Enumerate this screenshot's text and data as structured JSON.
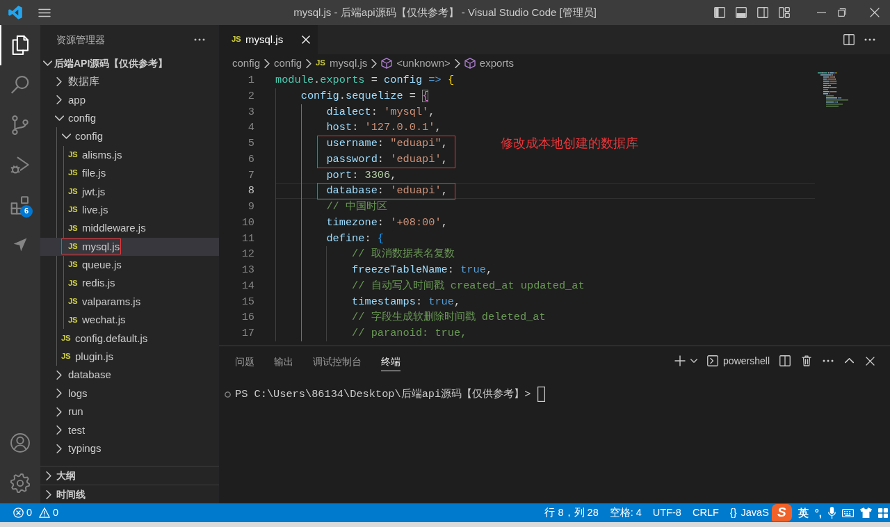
{
  "window": {
    "title": "mysql.js - 后端api源码【仅供参考】 - Visual Studio Code [管理员]"
  },
  "activity_bar": {
    "items": [
      {
        "kind": "explorer",
        "selected": true
      },
      {
        "kind": "search",
        "selected": false
      },
      {
        "kind": "source-control",
        "selected": false
      },
      {
        "kind": "run-debug",
        "selected": false
      },
      {
        "kind": "extensions",
        "selected": false,
        "badge": "6"
      },
      {
        "kind": "send",
        "selected": false
      }
    ],
    "bottom": [
      {
        "kind": "account"
      },
      {
        "kind": "settings"
      }
    ]
  },
  "sidebar": {
    "title": "资源管理器",
    "tree": {
      "label": "后端API源码【仅供参考】",
      "expanded": true,
      "children": [
        {
          "kind": "folder",
          "label": "数据库",
          "expanded": false,
          "selected": false,
          "marked": false
        },
        {
          "kind": "folder",
          "label": "app",
          "expanded": false,
          "selected": false,
          "marked": false
        },
        {
          "kind": "folder",
          "label": "config",
          "expanded": true,
          "selected": false,
          "marked": false,
          "children": [
            {
              "kind": "folder",
              "label": "config",
              "expanded": true,
              "selected": false,
              "marked": false,
              "children": [
                {
                  "kind": "file",
                  "icon_text": "JS",
                  "label": "alisms.js",
                  "selected": false,
                  "marked": false
                },
                {
                  "kind": "file",
                  "icon_text": "JS",
                  "label": "file.js",
                  "selected": false,
                  "marked": false
                },
                {
                  "kind": "file",
                  "icon_text": "JS",
                  "label": "jwt.js",
                  "selected": false,
                  "marked": false
                },
                {
                  "kind": "file",
                  "icon_text": "JS",
                  "label": "live.js",
                  "selected": false,
                  "marked": false
                },
                {
                  "kind": "file",
                  "icon_text": "JS",
                  "label": "middleware.js",
                  "selected": false,
                  "marked": false
                },
                {
                  "kind": "file",
                  "icon_text": "JS",
                  "label": "mysql.js",
                  "selected": true,
                  "marked": true
                },
                {
                  "kind": "file",
                  "icon_text": "JS",
                  "label": "queue.js",
                  "selected": false,
                  "marked": false
                },
                {
                  "kind": "file",
                  "icon_text": "JS",
                  "label": "redis.js",
                  "selected": false,
                  "marked": false
                },
                {
                  "kind": "file",
                  "icon_text": "JS",
                  "label": "valparams.js",
                  "selected": false,
                  "marked": false
                },
                {
                  "kind": "file",
                  "icon_text": "JS",
                  "label": "wechat.js",
                  "selected": false,
                  "marked": false
                }
              ]
            },
            {
              "kind": "file",
              "icon_text": "JS",
              "label": "config.default.js",
              "selected": false,
              "marked": false
            },
            {
              "kind": "file",
              "icon_text": "JS",
              "label": "plugin.js",
              "selected": false,
              "marked": false
            }
          ]
        },
        {
          "kind": "folder",
          "label": "database",
          "expanded": false,
          "selected": false,
          "marked": false
        },
        {
          "kind": "folder",
          "label": "logs",
          "expanded": false,
          "selected": false,
          "marked": false
        },
        {
          "kind": "folder",
          "label": "run",
          "expanded": false,
          "selected": false,
          "marked": false
        },
        {
          "kind": "folder",
          "label": "test",
          "expanded": false,
          "selected": false,
          "marked": false
        },
        {
          "kind": "folder",
          "label": "typings",
          "expanded": false,
          "selected": false,
          "marked": false
        }
      ]
    },
    "sections": [
      {
        "label": "大纲",
        "expanded": false
      },
      {
        "label": "时间线",
        "expanded": false
      }
    ]
  },
  "editor": {
    "tabs": [
      {
        "icon_text": "JS",
        "label": "mysql.js",
        "selected": true
      }
    ],
    "breadcrumbs": [
      {
        "kind": "folder",
        "label": "config"
      },
      {
        "kind": "folder",
        "label": "config"
      },
      {
        "kind": "file",
        "icon_text": "JS",
        "label": "mysql.js"
      },
      {
        "kind": "symbol",
        "label": "<unknown>"
      },
      {
        "kind": "symbol",
        "label": "exports"
      }
    ],
    "code": [
      {
        "number": "1",
        "current": false,
        "marked": false,
        "tokens": [
          {
            "kind": "obj",
            "text": "module"
          },
          {
            "kind": "punct",
            "text": "."
          },
          {
            "kind": "obj",
            "text": "exports"
          },
          {
            "kind": "punct",
            "text": " = "
          },
          {
            "kind": "var",
            "text": "config"
          },
          {
            "kind": "kw",
            "text": " => "
          },
          {
            "kind": "brace1",
            "text": "{"
          }
        ],
        "children": [
          {
            "number": "2",
            "current": false,
            "marked": false,
            "tokens": [
              {
                "kind": "var",
                "text": "config"
              },
              {
                "kind": "punct",
                "text": "."
              },
              {
                "kind": "var",
                "text": "sequelize"
              },
              {
                "kind": "punct",
                "text": " = "
              },
              {
                "kind": "brace-match",
                "text": "{"
              }
            ],
            "children": [
              {
                "number": "3",
                "current": false,
                "marked": false,
                "tokens": [
                  {
                    "kind": "prop",
                    "text": "dialect"
                  },
                  {
                    "kind": "punct",
                    "text": ": "
                  },
                  {
                    "kind": "str",
                    "text": "'mysql'"
                  },
                  {
                    "kind": "punct",
                    "text": ","
                  }
                ]
              },
              {
                "number": "4",
                "current": false,
                "marked": false,
                "tokens": [
                  {
                    "kind": "prop",
                    "text": "host"
                  },
                  {
                    "kind": "punct",
                    "text": ": "
                  },
                  {
                    "kind": "str",
                    "text": "'127.0.0.1'"
                  },
                  {
                    "kind": "punct",
                    "text": ","
                  }
                ]
              },
              {
                "number": "5",
                "current": false,
                "marked": true,
                "tokens": [
                  {
                    "kind": "prop",
                    "text": "username"
                  },
                  {
                    "kind": "punct",
                    "text": ": "
                  },
                  {
                    "kind": "str",
                    "text": "\"eduapi\""
                  },
                  {
                    "kind": "punct",
                    "text": ","
                  }
                ]
              },
              {
                "number": "6",
                "current": false,
                "marked": true,
                "tokens": [
                  {
                    "kind": "prop",
                    "text": "password"
                  },
                  {
                    "kind": "punct",
                    "text": ": "
                  },
                  {
                    "kind": "str",
                    "text": "'eduapi'"
                  },
                  {
                    "kind": "punct",
                    "text": ","
                  }
                ]
              },
              {
                "number": "7",
                "current": false,
                "marked": false,
                "tokens": [
                  {
                    "kind": "prop",
                    "text": "port"
                  },
                  {
                    "kind": "punct",
                    "text": ": "
                  },
                  {
                    "kind": "num",
                    "text": "3306"
                  },
                  {
                    "kind": "punct",
                    "text": ","
                  }
                ]
              },
              {
                "number": "8",
                "current": true,
                "marked": true,
                "tokens": [
                  {
                    "kind": "prop",
                    "text": "database"
                  },
                  {
                    "kind": "punct",
                    "text": ": "
                  },
                  {
                    "kind": "str",
                    "text": "'eduapi'"
                  },
                  {
                    "kind": "punct",
                    "text": ","
                  }
                ]
              },
              {
                "number": "9",
                "current": false,
                "marked": false,
                "tokens": [
                  {
                    "kind": "comment",
                    "text": "// 中国时区"
                  }
                ]
              },
              {
                "number": "10",
                "current": false,
                "marked": false,
                "tokens": [
                  {
                    "kind": "prop",
                    "text": "timezone"
                  },
                  {
                    "kind": "punct",
                    "text": ": "
                  },
                  {
                    "kind": "str",
                    "text": "'+08:00'"
                  },
                  {
                    "kind": "punct",
                    "text": ","
                  }
                ]
              },
              {
                "number": "11",
                "current": false,
                "marked": false,
                "tokens": [
                  {
                    "kind": "prop",
                    "text": "define"
                  },
                  {
                    "kind": "punct",
                    "text": ": "
                  },
                  {
                    "kind": "brace3",
                    "text": "{"
                  }
                ],
                "children": [
                  {
                    "number": "12",
                    "current": false,
                    "marked": false,
                    "tokens": [
                      {
                        "kind": "comment",
                        "text": "// 取消数据表名复数"
                      }
                    ]
                  },
                  {
                    "number": "13",
                    "current": false,
                    "marked": false,
                    "tokens": [
                      {
                        "kind": "prop",
                        "text": "freezeTableName"
                      },
                      {
                        "kind": "punct",
                        "text": ": "
                      },
                      {
                        "kind": "bool",
                        "text": "true"
                      },
                      {
                        "kind": "punct",
                        "text": ","
                      }
                    ]
                  },
                  {
                    "number": "14",
                    "current": false,
                    "marked": false,
                    "tokens": [
                      {
                        "kind": "comment",
                        "text": "// 自动写入时间戳 created_at updated_at"
                      }
                    ]
                  },
                  {
                    "number": "15",
                    "current": false,
                    "marked": false,
                    "tokens": [
                      {
                        "kind": "prop",
                        "text": "timestamps"
                      },
                      {
                        "kind": "punct",
                        "text": ": "
                      },
                      {
                        "kind": "bool",
                        "text": "true"
                      },
                      {
                        "kind": "punct",
                        "text": ","
                      }
                    ]
                  },
                  {
                    "number": "16",
                    "current": false,
                    "marked": false,
                    "tokens": [
                      {
                        "kind": "comment",
                        "text": "// 字段生成软删除时间戳 deleted_at"
                      }
                    ]
                  },
                  {
                    "number": "17",
                    "current": false,
                    "marked": false,
                    "tokens": [
                      {
                        "kind": "comment",
                        "text": "// paranoid: true,"
                      }
                    ]
                  }
                ]
              }
            ]
          }
        ]
      }
    ],
    "note": "修改成本地创建的数据库"
  },
  "panel": {
    "tabs": [
      {
        "label": "问题",
        "selected": false
      },
      {
        "label": "输出",
        "selected": false
      },
      {
        "label": "调试控制台",
        "selected": false
      },
      {
        "label": "终端",
        "selected": true
      }
    ],
    "shell": "powershell",
    "prompt": "PS C:\\Users\\86134\\Desktop\\后端api源码【仅供参考】>"
  },
  "status_bar": {
    "errors": "0",
    "warnings": "0",
    "items": [
      {
        "kind": "text",
        "label": "行 8，列 28"
      },
      {
        "kind": "text",
        "label": "空格: 4"
      },
      {
        "kind": "text",
        "label": "UTF-8"
      },
      {
        "kind": "text",
        "label": "CRLF"
      },
      {
        "kind": "language",
        "icon_text": "{}",
        "label": "JavaS"
      }
    ]
  },
  "ime": {
    "logo": "S",
    "mode": "英",
    "punctuation": "°,"
  }
}
